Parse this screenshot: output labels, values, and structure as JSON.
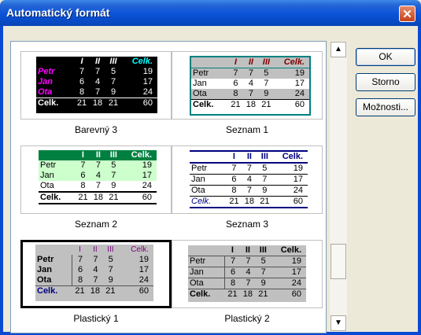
{
  "window": {
    "title": "Automatický formát",
    "close_glyph": "✕"
  },
  "buttons": {
    "ok": "OK",
    "cancel": "Storno",
    "options": "Možnosti..."
  },
  "scroll": {
    "up": "▲",
    "down": "▼"
  },
  "styles": [
    {
      "caption": "Barevný 3",
      "header": [
        "",
        "I",
        "II",
        "III",
        "Celk."
      ],
      "rows": [
        [
          "Petr",
          "7",
          "7",
          "5",
          "19"
        ],
        [
          "Jan",
          "6",
          "4",
          "7",
          "17"
        ],
        [
          "Ota",
          "8",
          "7",
          "9",
          "24"
        ]
      ],
      "total": [
        "Celk.",
        "21",
        "18",
        "21",
        "60"
      ]
    },
    {
      "caption": "Seznam 1",
      "header": [
        "",
        "I",
        "II",
        "III",
        "Celk."
      ],
      "rows": [
        [
          "Petr",
          "7",
          "7",
          "5",
          "19"
        ],
        [
          "Jan",
          "6",
          "4",
          "7",
          "17"
        ],
        [
          "Ota",
          "8",
          "7",
          "9",
          "24"
        ]
      ],
      "total": [
        "Celk.",
        "21",
        "18",
        "21",
        "60"
      ]
    },
    {
      "caption": "Seznam 2",
      "header": [
        "",
        "I",
        "II",
        "III",
        "Celk."
      ],
      "rows": [
        [
          "Petr",
          "7",
          "7",
          "5",
          "19"
        ],
        [
          "Jan",
          "6",
          "4",
          "7",
          "17"
        ],
        [
          "Ota",
          "8",
          "7",
          "9",
          "24"
        ]
      ],
      "total": [
        "Celk.",
        "21",
        "18",
        "21",
        "60"
      ]
    },
    {
      "caption": "Seznam 3",
      "header": [
        "",
        "I",
        "II",
        "III",
        "Celk."
      ],
      "rows": [
        [
          "Petr",
          "7",
          "7",
          "5",
          "19"
        ],
        [
          "Jan",
          "6",
          "4",
          "7",
          "17"
        ],
        [
          "Ota",
          "8",
          "7",
          "9",
          "24"
        ]
      ],
      "total": [
        "Celk.",
        "21",
        "18",
        "21",
        "60"
      ]
    },
    {
      "caption": "Plastický 1",
      "header": [
        "",
        "I",
        "II",
        "III",
        "Celk."
      ],
      "rows": [
        [
          "Petr",
          "7",
          "7",
          "5",
          "19"
        ],
        [
          "Jan",
          "6",
          "4",
          "7",
          "17"
        ],
        [
          "Ota",
          "8",
          "7",
          "9",
          "24"
        ]
      ],
      "total": [
        "Celk.",
        "21",
        "18",
        "21",
        "60"
      ]
    },
    {
      "caption": "Plastický 2",
      "header": [
        "",
        "I",
        "II",
        "III",
        "Celk."
      ],
      "rows": [
        [
          "Petr",
          "7",
          "7",
          "5",
          "19"
        ],
        [
          "Jan",
          "6",
          "4",
          "7",
          "17"
        ],
        [
          "Ota",
          "8",
          "7",
          "9",
          "24"
        ]
      ],
      "total": [
        "Celk.",
        "21",
        "18",
        "21",
        "60"
      ]
    }
  ],
  "selected_style": "Plastický 1",
  "colors": {
    "titlebar": "#0a52d9",
    "black_bg": "#000000",
    "magenta": "#ff00ff",
    "teal": "#008080",
    "green": "#008040",
    "light_green": "#ccffcc",
    "purple": "#800080",
    "gray": "#c0c0c0",
    "navy": "#000080"
  }
}
